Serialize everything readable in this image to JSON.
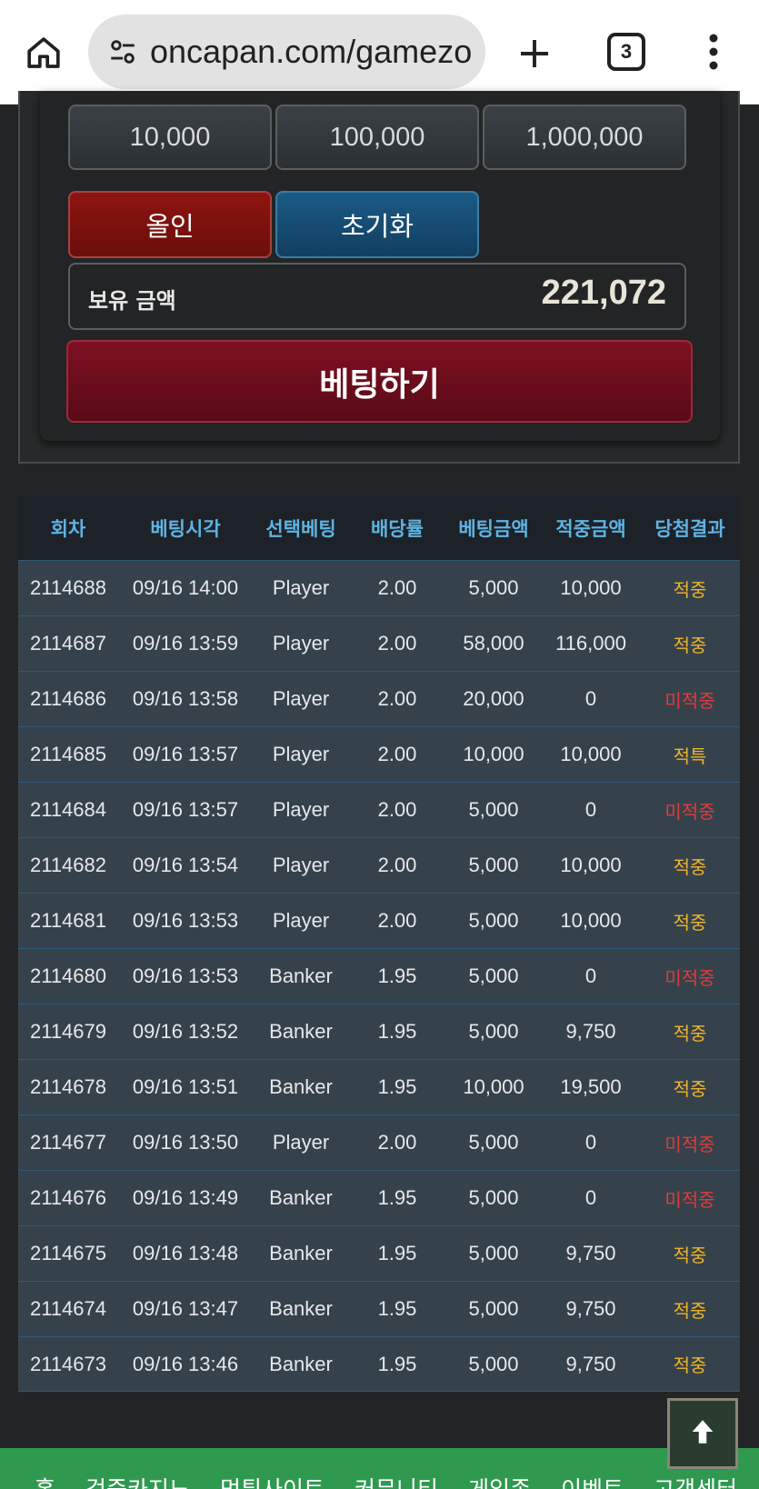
{
  "browser": {
    "url": "oncapan.com/gamezo",
    "tab_count": "3"
  },
  "bet_panel": {
    "chips": [
      "10,000",
      "100,000",
      "1,000,000"
    ],
    "allin_label": "올인",
    "reset_label": "초기화",
    "balance_label": "보유 금액",
    "balance_value": "221,072",
    "bet_label": "베팅하기"
  },
  "history": {
    "headers": [
      "회차",
      "베팅시각",
      "선택베팅",
      "배당률",
      "베팅금액",
      "적중금액",
      "당첨결과"
    ],
    "rows": [
      [
        "2114688",
        "09/16 14:00",
        "Player",
        "2.00",
        "5,000",
        "10,000",
        "적중"
      ],
      [
        "2114687",
        "09/16 13:59",
        "Player",
        "2.00",
        "58,000",
        "116,000",
        "적중"
      ],
      [
        "2114686",
        "09/16 13:58",
        "Player",
        "2.00",
        "20,000",
        "0",
        "미적중"
      ],
      [
        "2114685",
        "09/16 13:57",
        "Player",
        "2.00",
        "10,000",
        "10,000",
        "적특"
      ],
      [
        "2114684",
        "09/16 13:57",
        "Player",
        "2.00",
        "5,000",
        "0",
        "미적중"
      ],
      [
        "2114682",
        "09/16 13:54",
        "Player",
        "2.00",
        "5,000",
        "10,000",
        "적중"
      ],
      [
        "2114681",
        "09/16 13:53",
        "Player",
        "2.00",
        "5,000",
        "10,000",
        "적중"
      ],
      [
        "2114680",
        "09/16 13:53",
        "Banker",
        "1.95",
        "5,000",
        "0",
        "미적중"
      ],
      [
        "2114679",
        "09/16 13:52",
        "Banker",
        "1.95",
        "5,000",
        "9,750",
        "적중"
      ],
      [
        "2114678",
        "09/16 13:51",
        "Banker",
        "1.95",
        "10,000",
        "19,500",
        "적중"
      ],
      [
        "2114677",
        "09/16 13:50",
        "Player",
        "2.00",
        "5,000",
        "0",
        "미적중"
      ],
      [
        "2114676",
        "09/16 13:49",
        "Banker",
        "1.95",
        "5,000",
        "0",
        "미적중"
      ],
      [
        "2114675",
        "09/16 13:48",
        "Banker",
        "1.95",
        "5,000",
        "9,750",
        "적중"
      ],
      [
        "2114674",
        "09/16 13:47",
        "Banker",
        "1.95",
        "5,000",
        "9,750",
        "적중"
      ],
      [
        "2114673",
        "09/16 13:46",
        "Banker",
        "1.95",
        "5,000",
        "9,750",
        "적중"
      ]
    ]
  },
  "bottom_nav": {
    "items": [
      "홈",
      "검증카지노",
      "먹튀사이트",
      "커뮤니티",
      "게임존",
      "이벤트",
      "고객센터"
    ]
  },
  "colors": {
    "hit": "#f0b429",
    "miss": "#e23b3b",
    "header_text": "#5fb3e3",
    "nav_bg": "#2f9a4f"
  },
  "icons": {
    "home": "home-icon",
    "site_info": "tune-icon",
    "new_tab": "plus-icon",
    "menu": "kebab-menu-icon",
    "scroll_top": "arrow-up-icon"
  }
}
